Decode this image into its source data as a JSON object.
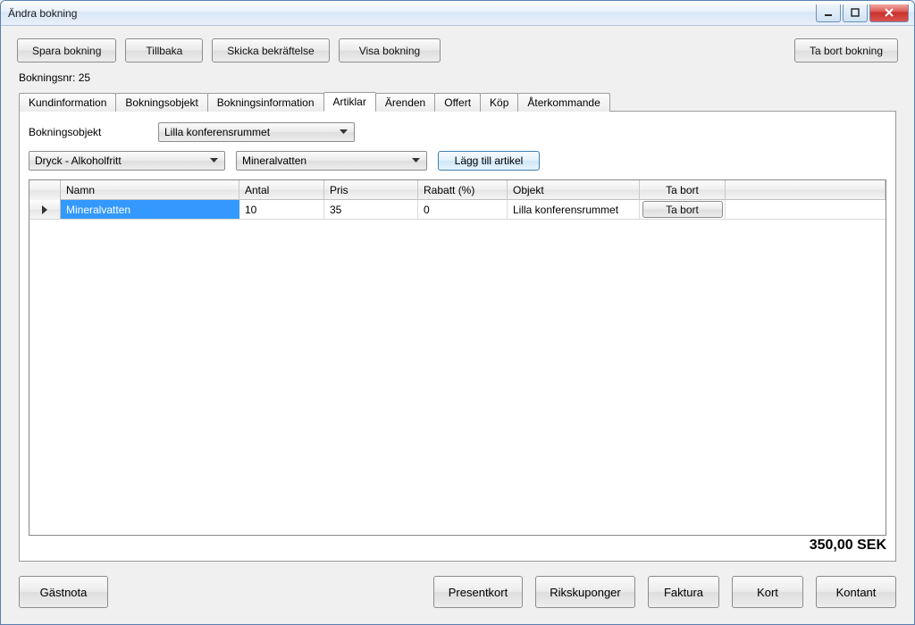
{
  "window": {
    "title": "Ändra bokning"
  },
  "toolbar": {
    "save": "Spara bokning",
    "back": "Tillbaka",
    "confirm": "Skicka bekräftelse",
    "show": "Visa bokning",
    "delete": "Ta bort bokning"
  },
  "booking_label": "Bokningsnr: 25",
  "tabs": [
    "Kundinformation",
    "Bokningsobjekt",
    "Bokningsinformation",
    "Artiklar",
    "Ärenden",
    "Offert",
    "Köp",
    "Återkommande"
  ],
  "active_tab_index": 3,
  "panel": {
    "objekt_label": "Bokningsobjekt",
    "objekt_value": "Lilla konferensrummet",
    "cat_value": "Dryck - Alkoholfritt",
    "item_value": "Mineralvatten",
    "add_label": "Lägg till artikel"
  },
  "grid": {
    "headers": [
      "Namn",
      "Antal",
      "Pris",
      "Rabatt (%)",
      "Objekt",
      "Ta bort"
    ],
    "rows": [
      {
        "namn": "Mineralvatten",
        "antal": "10",
        "pris": "35",
        "rabatt": "0",
        "objekt": "Lilla konferensrummet",
        "tabort": "Ta bort"
      }
    ]
  },
  "total": "350,00 SEK",
  "bottom": {
    "gastnota": "Gästnota",
    "presentkort": "Presentkort",
    "rikskuponger": "Rikskuponger",
    "faktura": "Faktura",
    "kort": "Kort",
    "kontant": "Kontant"
  }
}
